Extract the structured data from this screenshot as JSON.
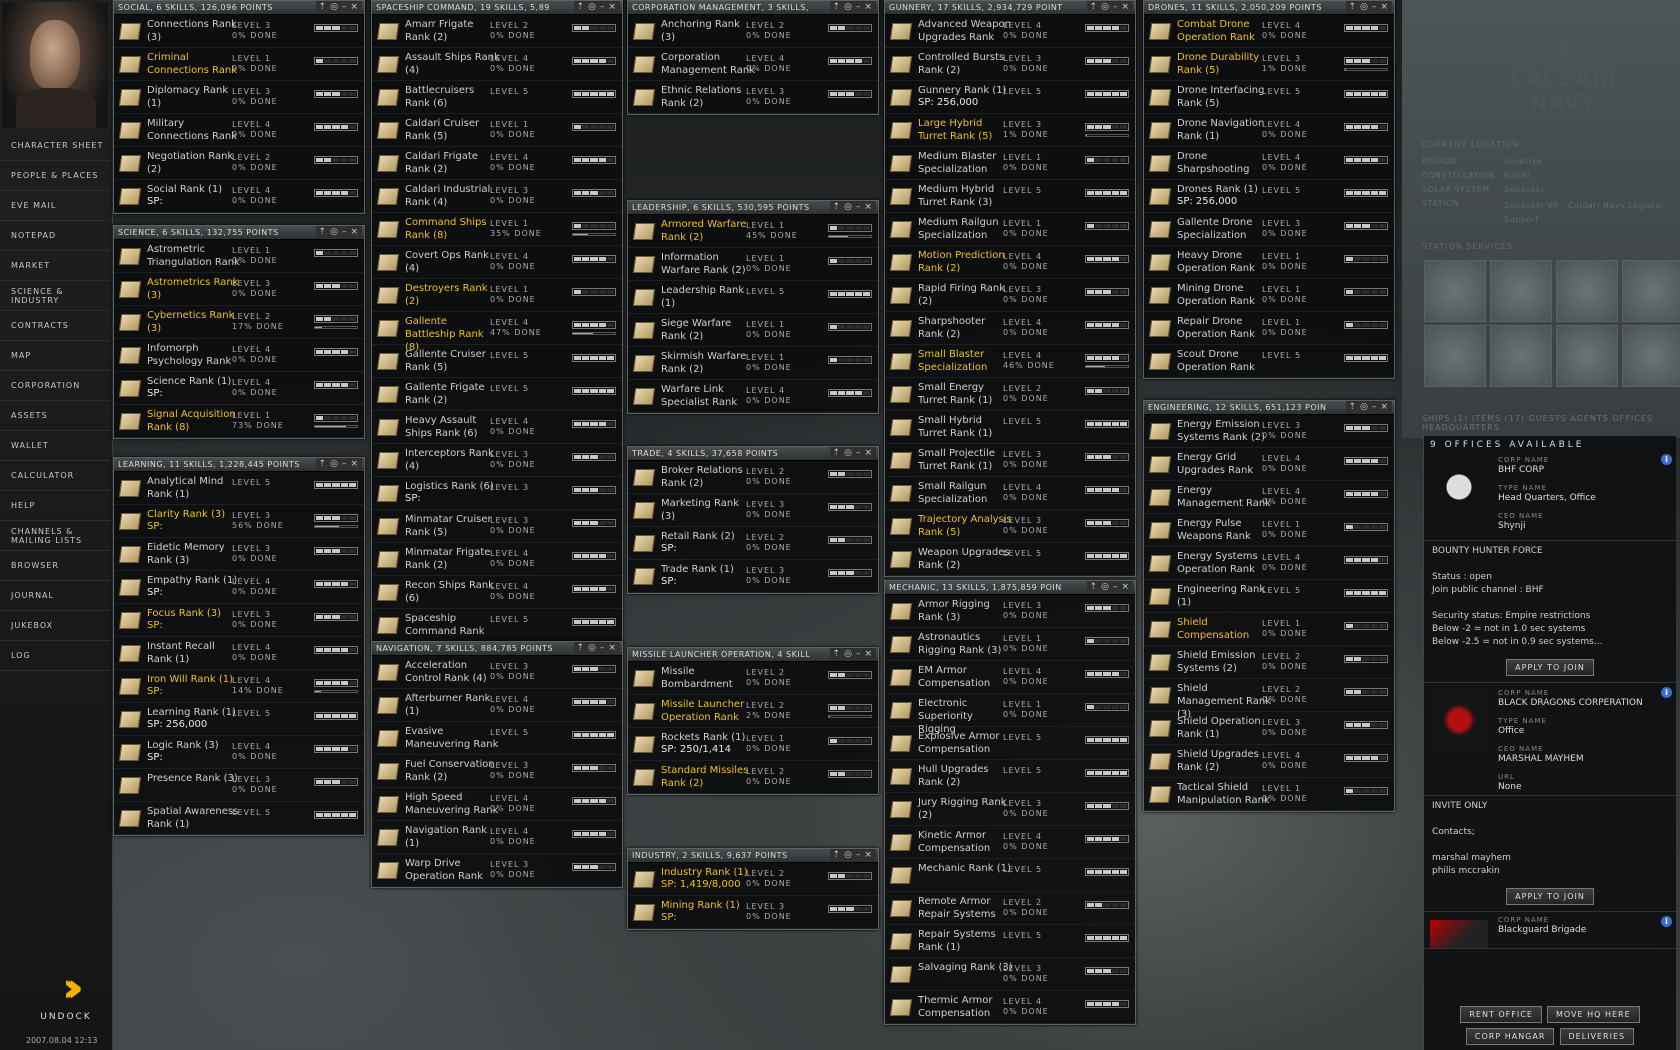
{
  "nav": {
    "items": [
      "Character Sheet",
      "People & Places",
      "EVE Mail",
      "Notepad",
      "Market",
      "Science & Industry",
      "Contracts",
      "Map",
      "Corporation",
      "Assets",
      "Wallet",
      "Calculator",
      "Help",
      "Channels & Mailing Lists",
      "Browser",
      "Journal",
      "Jukebox",
      "Log"
    ],
    "undock_label": "UNDOCK",
    "clock": "2007.08.04 12:13"
  },
  "windows": [
    {
      "title": "SOCIAL, 6 SKILLS, 126,096 POINTS",
      "skills": [
        {
          "name": "Connections Rank (3)",
          "level": 3,
          "done": "0% DONE"
        },
        {
          "name": "Criminal Connections Rank",
          "level": 1,
          "done": "0% DONE",
          "hl": true
        },
        {
          "name": "Diplomacy Rank (1)",
          "level": 3,
          "done": "0% DONE"
        },
        {
          "name": "Military Connections Rank",
          "level": 4,
          "done": "0% DONE"
        },
        {
          "name": "Negotiation Rank (2)",
          "level": 2,
          "done": "0% DONE"
        },
        {
          "name": "Social Rank (1)",
          "level": 4,
          "done": "0% DONE",
          "sp": "SP:"
        }
      ]
    },
    {
      "title": "SCIENCE, 6 SKILLS, 132,755 POINTS",
      "skills": [
        {
          "name": "Astrometric Triangulation Rank",
          "level": 1,
          "done": "0% DONE"
        },
        {
          "name": "Astrometrics Rank (3)",
          "level": 3,
          "done": "0% DONE",
          "hl": true
        },
        {
          "name": "Cybernetics Rank (3)",
          "level": 2,
          "done": "17% DONE",
          "hl": true,
          "pct": 17
        },
        {
          "name": "Infomorph Psychology Rank",
          "level": 4,
          "done": "0% DONE"
        },
        {
          "name": "Science Rank (1)",
          "level": 4,
          "done": "0% DONE",
          "sp": "SP:"
        },
        {
          "name": "Signal Acquisition Rank (8)",
          "level": 1,
          "done": "73% DONE",
          "hl": true,
          "pct": 73
        }
      ]
    },
    {
      "title": "LEARNING, 11 SKILLS, 1,228,445 POINTS",
      "skills": [
        {
          "name": "Analytical Mind Rank (1)",
          "level": 5,
          "done": ""
        },
        {
          "name": "Clarity Rank (3)",
          "level": 3,
          "done": "56% DONE",
          "hl": true,
          "pct": 56,
          "sp": "SP:",
          "sphl": true
        },
        {
          "name": "Eidetic Memory Rank (3)",
          "level": 3,
          "done": "0% DONE"
        },
        {
          "name": "Empathy Rank (1)",
          "level": 4,
          "done": "0% DONE",
          "sp": "SP:"
        },
        {
          "name": "Focus Rank (3)",
          "level": 3,
          "done": "0% DONE",
          "hl": true,
          "sp": "SP:",
          "sphl": true
        },
        {
          "name": "Instant Recall Rank (1)",
          "level": 4,
          "done": "0% DONE"
        },
        {
          "name": "Iron Will Rank (1)",
          "level": 4,
          "done": "14% DONE",
          "hl": true,
          "pct": 14,
          "sp": "SP:",
          "sphl": true
        },
        {
          "name": "Learning Rank (1)",
          "level": 5,
          "done": "",
          "sp": "SP: 256,000"
        },
        {
          "name": "Logic Rank (3)",
          "level": 4,
          "done": "0% DONE",
          "sp": "SP:"
        },
        {
          "name": "Presence Rank (3)",
          "level": 3,
          "done": "0% DONE"
        },
        {
          "name": "Spatial Awareness Rank (1)",
          "level": 5,
          "done": ""
        }
      ]
    },
    {
      "title": "SPACESHIP COMMAND, 19 SKILLS, 5,89",
      "skills": [
        {
          "name": "Amarr Frigate Rank (2)",
          "level": 2,
          "done": "0% DONE"
        },
        {
          "name": "Assault Ships Rank (4)",
          "level": 4,
          "done": "0% DONE"
        },
        {
          "name": "Battlecruisers Rank (6)",
          "level": 5,
          "done": ""
        },
        {
          "name": "Caldari Cruiser Rank (5)",
          "level": 1,
          "done": "0% DONE"
        },
        {
          "name": "Caldari Frigate Rank (2)",
          "level": 4,
          "done": "0% DONE"
        },
        {
          "name": "Caldari Industrial Rank (4)",
          "level": 3,
          "done": "0% DONE"
        },
        {
          "name": "Command Ships Rank (8)",
          "level": 1,
          "done": "35% DONE",
          "hl": true,
          "pct": 35
        },
        {
          "name": "Covert Ops Rank (4)",
          "level": 4,
          "done": "0% DONE"
        },
        {
          "name": "Destroyers Rank (2)",
          "level": 1,
          "done": "0% DONE",
          "hl": true
        },
        {
          "name": "Gallente Battleship Rank (8)",
          "level": 4,
          "done": "47% DONE",
          "hl": true,
          "pct": 47
        },
        {
          "name": "Gallente Cruiser Rank (5)",
          "level": 5,
          "done": ""
        },
        {
          "name": "Gallente Frigate Rank (2)",
          "level": 5,
          "done": ""
        },
        {
          "name": "Heavy Assault Ships Rank (6)",
          "level": 4,
          "done": "0% DONE"
        },
        {
          "name": "Interceptors Rank (4)",
          "level": 3,
          "done": "0% DONE"
        },
        {
          "name": "Logistics Rank (6)",
          "level": 3,
          "done": "",
          "sp": "SP:"
        },
        {
          "name": "Minmatar Cruiser Rank (5)",
          "level": 3,
          "done": "0% DONE"
        },
        {
          "name": "Minmatar Frigate Rank (2)",
          "level": 4,
          "done": "0% DONE"
        },
        {
          "name": "Recon Ships Rank (6)",
          "level": 4,
          "done": "0% DONE"
        },
        {
          "name": "Spaceship Command Rank",
          "level": 5,
          "done": ""
        }
      ]
    },
    {
      "title": "NAVIGATION, 7 SKILLS, 884,785 POINTS",
      "skills": [
        {
          "name": "Acceleration Control Rank (4)",
          "level": 3,
          "done": "0% DONE"
        },
        {
          "name": "Afterburner Rank (1)",
          "level": 4,
          "done": "0% DONE"
        },
        {
          "name": "Evasive Maneuvering Rank",
          "level": 5,
          "done": ""
        },
        {
          "name": "Fuel Conservation Rank (2)",
          "level": 3,
          "done": "0% DONE"
        },
        {
          "name": "High Speed Maneuvering Rank",
          "level": 4,
          "done": "0% DONE"
        },
        {
          "name": "Navigation Rank (1)",
          "level": 4,
          "done": "0% DONE"
        },
        {
          "name": "Warp Drive Operation Rank",
          "level": 3,
          "done": "0% DONE"
        }
      ]
    },
    {
      "title": "CORPORATION MANAGEMENT, 3 SKILLS,",
      "skills": [
        {
          "name": "Anchoring Rank (3)",
          "level": 2,
          "done": "0% DONE"
        },
        {
          "name": "Corporation Management Rank",
          "level": 4,
          "done": "0% DONE"
        },
        {
          "name": "Ethnic Relations Rank (2)",
          "level": 3,
          "done": "0% DONE"
        }
      ]
    },
    {
      "title": "LEADERSHIP, 6 SKILLS, 530,595 POINTS",
      "skills": [
        {
          "name": "Armored Warfare Rank (2)",
          "level": 1,
          "done": "45% DONE",
          "hl": true,
          "pct": 45
        },
        {
          "name": "Information Warfare Rank (2)",
          "level": 1,
          "done": "0% DONE"
        },
        {
          "name": "Leadership Rank (1)",
          "level": 5,
          "done": ""
        },
        {
          "name": "Siege Warfare Rank (2)",
          "level": 1,
          "done": "0% DONE"
        },
        {
          "name": "Skirmish Warfare Rank (2)",
          "level": 1,
          "done": "0% DONE"
        },
        {
          "name": "Warfare Link Specialist Rank",
          "level": 4,
          "done": "0% DONE"
        }
      ]
    },
    {
      "title": "TRADE, 4 SKILLS, 37,658 POINTS",
      "skills": [
        {
          "name": "Broker Relations Rank (2)",
          "level": 2,
          "done": "0% DONE"
        },
        {
          "name": "Marketing Rank (3)",
          "level": 3,
          "done": "0% DONE"
        },
        {
          "name": "Retail Rank (2)",
          "level": 2,
          "done": "0% DONE",
          "sp": "SP:"
        },
        {
          "name": "Trade Rank (1)",
          "level": 3,
          "done": "0% DONE",
          "sp": "SP:"
        }
      ]
    },
    {
      "title": "MISSILE LAUNCHER OPERATION, 4 SKILL",
      "skills": [
        {
          "name": "Missile Bombardment",
          "level": 2,
          "done": "0% DONE"
        },
        {
          "name": "Missile Launcher Operation Rank",
          "level": 2,
          "done": "2% DONE",
          "hl": true,
          "pct": 2
        },
        {
          "name": "Rockets Rank (1)",
          "level": 1,
          "done": "0% DONE",
          "sp": "SP: 250/1,414"
        },
        {
          "name": "Standard Missiles Rank (2)",
          "level": 2,
          "done": "0% DONE",
          "hl": true
        }
      ]
    },
    {
      "title": "INDUSTRY, 2 SKILLS, 9,637 POINTS",
      "skills": [
        {
          "name": "Industry Rank (1)",
          "level": 2,
          "done": "0% DONE",
          "hl": true,
          "sp": "SP: 1,419/8,000",
          "sphl": true
        },
        {
          "name": "Mining Rank (1)",
          "level": 3,
          "done": "0% DONE",
          "hl": true,
          "sp": "SP:",
          "sphl": true
        }
      ]
    },
    {
      "title": "GUNNERY, 17 SKILLS, 2,934,729 POINT",
      "skills": [
        {
          "name": "Advanced Weapon Upgrades Rank",
          "level": 4,
          "done": "0% DONE"
        },
        {
          "name": "Controlled Bursts Rank (2)",
          "level": 3,
          "done": "0% DONE"
        },
        {
          "name": "Gunnery Rank (1)",
          "level": 5,
          "done": "",
          "sp": "SP: 256,000"
        },
        {
          "name": "Large Hybrid Turret Rank (5)",
          "level": 3,
          "done": "1% DONE",
          "hl": true,
          "pct": 1
        },
        {
          "name": "Medium Blaster Specialization",
          "level": 1,
          "done": "0% DONE"
        },
        {
          "name": "Medium Hybrid Turret Rank (3)",
          "level": 5,
          "done": ""
        },
        {
          "name": "Medium Railgun Specialization",
          "level": 1,
          "done": "0% DONE"
        },
        {
          "name": "Motion Prediction Rank (2)",
          "level": 4,
          "done": "0% DONE",
          "hl": true
        },
        {
          "name": "Rapid Firing Rank (2)",
          "level": 3,
          "done": "0% DONE"
        },
        {
          "name": "Sharpshooter Rank (2)",
          "level": 4,
          "done": "0% DONE"
        },
        {
          "name": "Small Blaster Specialization",
          "level": 4,
          "done": "46% DONE",
          "hl": true,
          "pct": 46
        },
        {
          "name": "Small Energy Turret Rank (1)",
          "level": 2,
          "done": "0% DONE"
        },
        {
          "name": "Small Hybrid Turret Rank (1)",
          "level": 5,
          "done": ""
        },
        {
          "name": "Small Projectile Turret Rank (1)",
          "level": 3,
          "done": "0% DONE"
        },
        {
          "name": "Small Railgun Specialization",
          "level": 4,
          "done": "0% DONE"
        },
        {
          "name": "Trajectory Analysis Rank (5)",
          "level": 3,
          "done": "0% DONE",
          "hl": true
        },
        {
          "name": "Weapon Upgrades Rank (2)",
          "level": 5,
          "done": ""
        }
      ]
    },
    {
      "title": "MECHANIC, 13 SKILLS, 1,875,859 POIN",
      "skills": [
        {
          "name": "Armor Rigging Rank (3)",
          "level": 3,
          "done": "0% DONE"
        },
        {
          "name": "Astronautics Rigging Rank (3)",
          "level": 1,
          "done": "0% DONE"
        },
        {
          "name": "EM Armor Compensation",
          "level": 4,
          "done": "0% DONE"
        },
        {
          "name": "Electronic Superiority Rigging",
          "level": 1,
          "done": "0% DONE"
        },
        {
          "name": "Explosive Armor Compensation",
          "level": 5,
          "done": ""
        },
        {
          "name": "Hull Upgrades Rank (2)",
          "level": 5,
          "done": ""
        },
        {
          "name": "Jury Rigging Rank (2)",
          "level": 3,
          "done": "0% DONE"
        },
        {
          "name": "Kinetic Armor Compensation",
          "level": 4,
          "done": "0% DONE"
        },
        {
          "name": "Mechanic Rank (1)",
          "level": 5,
          "done": ""
        },
        {
          "name": "Remote Armor Repair Systems",
          "level": 2,
          "done": "0% DONE"
        },
        {
          "name": "Repair Systems Rank (1)",
          "level": 5,
          "done": ""
        },
        {
          "name": "Salvaging Rank (3)",
          "level": 3,
          "done": "0% DONE"
        },
        {
          "name": "Thermic Armor Compensation",
          "level": 4,
          "done": "0% DONE"
        }
      ]
    },
    {
      "title": "DRONES, 11 SKILLS, 2,050,209 POINTS",
      "skills": [
        {
          "name": "Combat Drone Operation Rank",
          "level": 4,
          "done": "0% DONE",
          "hl": true
        },
        {
          "name": "Drone Durability Rank (5)",
          "level": 3,
          "done": "1% DONE",
          "hl": true,
          "pct": 1
        },
        {
          "name": "Drone Interfacing Rank (5)",
          "level": 5,
          "done": ""
        },
        {
          "name": "Drone Navigation Rank (1)",
          "level": 4,
          "done": "0% DONE"
        },
        {
          "name": "Drone Sharpshooting",
          "level": 4,
          "done": "0% DONE"
        },
        {
          "name": "Drones Rank (1)",
          "level": 5,
          "done": "",
          "sp": "SP: 256,000"
        },
        {
          "name": "Gallente Drone Specialization",
          "level": 3,
          "done": "0% DONE"
        },
        {
          "name": "Heavy Drone Operation Rank",
          "level": 1,
          "done": "0% DONE"
        },
        {
          "name": "Mining Drone Operation Rank",
          "level": 1,
          "done": "0% DONE"
        },
        {
          "name": "Repair Drone Operation Rank",
          "level": 1,
          "done": "0% DONE"
        },
        {
          "name": "Scout Drone Operation Rank",
          "level": 5,
          "done": ""
        }
      ]
    },
    {
      "title": "ENGINEERING, 12 SKILLS, 651,123 POIN",
      "skills": [
        {
          "name": "Energy Emission Systems Rank (2)",
          "level": 3,
          "done": "0% DONE"
        },
        {
          "name": "Energy Grid Upgrades Rank",
          "level": 4,
          "done": "0% DONE"
        },
        {
          "name": "Energy Management Rank",
          "level": 4,
          "done": "0% DONE"
        },
        {
          "name": "Energy Pulse Weapons Rank",
          "level": 1,
          "done": "0% DONE"
        },
        {
          "name": "Energy Systems Operation Rank",
          "level": 4,
          "done": "0% DONE"
        },
        {
          "name": "Engineering Rank (1)",
          "level": 5,
          "done": ""
        },
        {
          "name": "Shield Compensation",
          "level": 1,
          "done": "0% DONE",
          "hl": true
        },
        {
          "name": "Shield Emission Systems (2)",
          "level": 2,
          "done": "0% DONE"
        },
        {
          "name": "Shield Management Rank (3)",
          "level": 2,
          "done": "0% DONE"
        },
        {
          "name": "Shield Operation Rank (1)",
          "level": 3,
          "done": "0% DONE"
        },
        {
          "name": "Shield Upgrades Rank (2)",
          "level": 4,
          "done": "0% DONE"
        },
        {
          "name": "Tactical Shield Manipulation Rank",
          "level": 1,
          "done": "0% DONE"
        }
      ]
    }
  ],
  "station": {
    "logo_line1": "CALDARI",
    "logo_line2": "NAVY",
    "current_location": "CURRENT LOCATION",
    "region_label": "REGION",
    "region": "Lonetrek",
    "constellation_label": "CONSTELLATION",
    "constellation": "Koichi",
    "system_label": "SOLAR SYSTEM",
    "system": "Sobaseki",
    "station_label": "STATION",
    "station": "Sobaseki VII - Caldari Navy Logistic Support",
    "services": "STATION SERVICES",
    "tabs": "SHIPS (1)   ITEMS (17)   GUESTS   AGENTS   OFFICES   HEADQUARTERS"
  },
  "offices": {
    "title": "9 OFFICES AVAILABLE",
    "corps": [
      {
        "corp_name_label": "CORP NAME",
        "corp_name": "BHF CORP",
        "type_label": "TYPE NAME",
        "type": "Head Quarters, Office",
        "ceo_label": "CEO NAME",
        "ceo": "Shynji"
      },
      {
        "corp_name_label": "CORP NAME",
        "corp_name": "BLACK DRAGONS CORPERATION",
        "type_label": "TYPE NAME",
        "type": "Office",
        "ceo_label": "CEO NAME",
        "ceo": "MARSHAL MAYHEM",
        "url_label": "URL",
        "url": "None"
      },
      {
        "corp_name_label": "CORP NAME",
        "corp_name": "Blackguard Brigade"
      }
    ],
    "desc1": "BOUNTY HUNTER FORCE\n\nStatus : open\nJoin public channel : BHF\n\nSecurity status: Empire restrictions\nBelow -2 = not in 1.0 sec systems\nBelow -2.5 = not in 0.9 sec systems...",
    "desc2": "INVITE ONLY\n\nContacts;\n\nmarshal mayhem\nphilis mccrakin",
    "apply": "APPLY TO JOIN",
    "rent": "RENT OFFICE",
    "movehq": "MOVE HQ HERE",
    "hangar": "CORP HANGAR",
    "deliveries": "DELIVERIES"
  }
}
